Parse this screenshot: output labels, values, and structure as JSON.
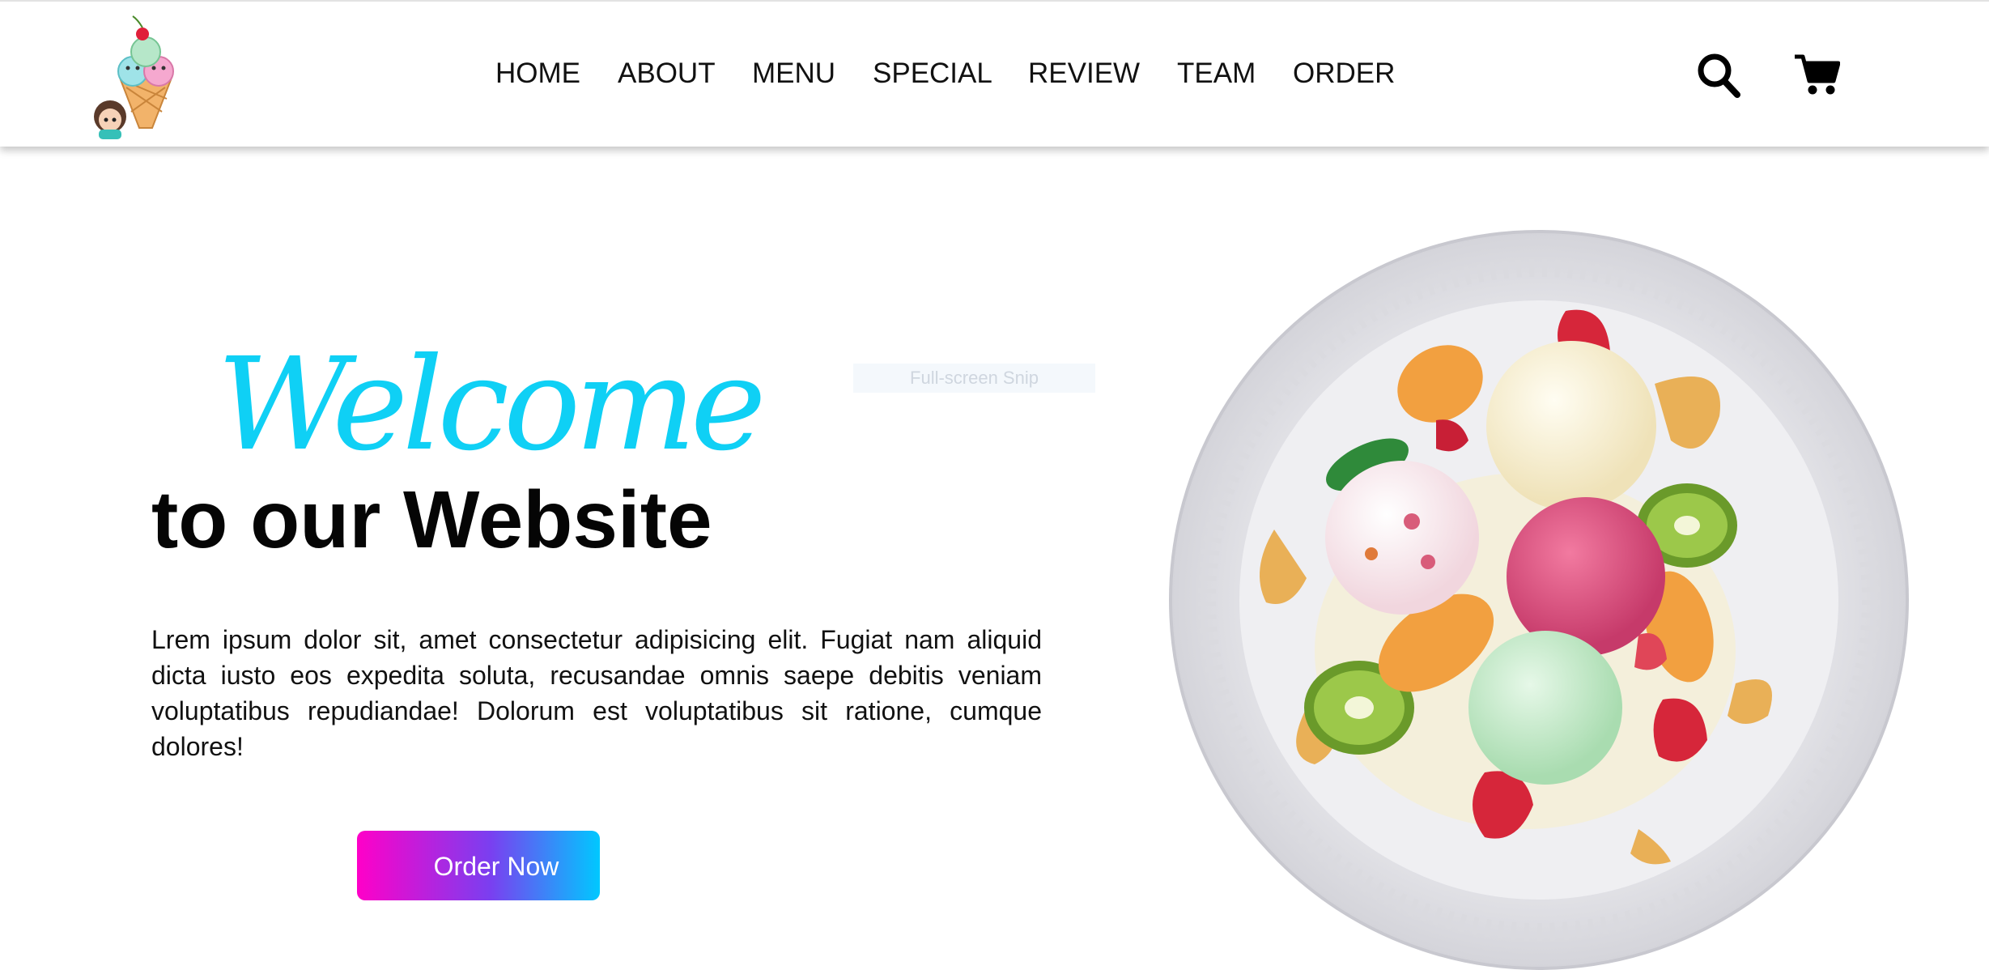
{
  "header": {
    "logo": "ice-cream-girl-logo",
    "nav": [
      {
        "label": "HOME"
      },
      {
        "label": "ABOUT"
      },
      {
        "label": "MENU"
      },
      {
        "label": "SPECIAL"
      },
      {
        "label": "REVIEW"
      },
      {
        "label": "TEAM"
      },
      {
        "label": "ORDER"
      }
    ],
    "icons": [
      "search-icon",
      "cart-icon"
    ]
  },
  "hero": {
    "title_script": "Welcome",
    "title_bold": "to our Website",
    "text": "Lrem ipsum dolor sit, amet consectetur adipisicing elit. Fugiat nam aliquid dicta iusto eos expedita soluta, recusandae omnis saepe debitis veniam voluptatibus repudiandae! Dolorum est voluptatibus sit ratione, cumque dolores!",
    "button_label": "Order Now",
    "image": "ice-cream-plate"
  },
  "overlay": {
    "snip_label": "Full-screen Snip"
  },
  "colors": {
    "accent_cyan": "#0fd0f5",
    "button_gradient_start": "#ff00c8",
    "button_gradient_end": "#00c8ff"
  }
}
